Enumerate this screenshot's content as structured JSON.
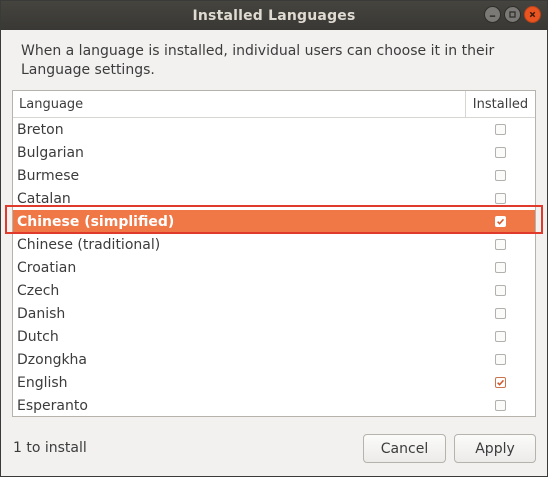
{
  "window": {
    "title": "Installed Languages"
  },
  "intro_text": "When a language is installed, individual users can choose it in their Language settings.",
  "list": {
    "columns": {
      "language": "Language",
      "installed": "Installed"
    },
    "rows": [
      {
        "language": "Breton",
        "installed": false,
        "selected": false
      },
      {
        "language": "Bulgarian",
        "installed": false,
        "selected": false
      },
      {
        "language": "Burmese",
        "installed": false,
        "selected": false
      },
      {
        "language": "Catalan",
        "installed": false,
        "selected": false
      },
      {
        "language": "Chinese (simplified)",
        "installed": true,
        "selected": true
      },
      {
        "language": "Chinese (traditional)",
        "installed": false,
        "selected": false
      },
      {
        "language": "Croatian",
        "installed": false,
        "selected": false
      },
      {
        "language": "Czech",
        "installed": false,
        "selected": false
      },
      {
        "language": "Danish",
        "installed": false,
        "selected": false
      },
      {
        "language": "Dutch",
        "installed": false,
        "selected": false
      },
      {
        "language": "Dzongkha",
        "installed": false,
        "selected": false
      },
      {
        "language": "English",
        "installed": true,
        "selected": false
      },
      {
        "language": "Esperanto",
        "installed": false,
        "selected": false
      }
    ]
  },
  "status_text": "1 to install",
  "buttons": {
    "cancel": "Cancel",
    "apply": "Apply"
  },
  "colors": {
    "accent": "#e95420",
    "selection": "#f07746",
    "highlight_outline": "#e03a2c"
  }
}
